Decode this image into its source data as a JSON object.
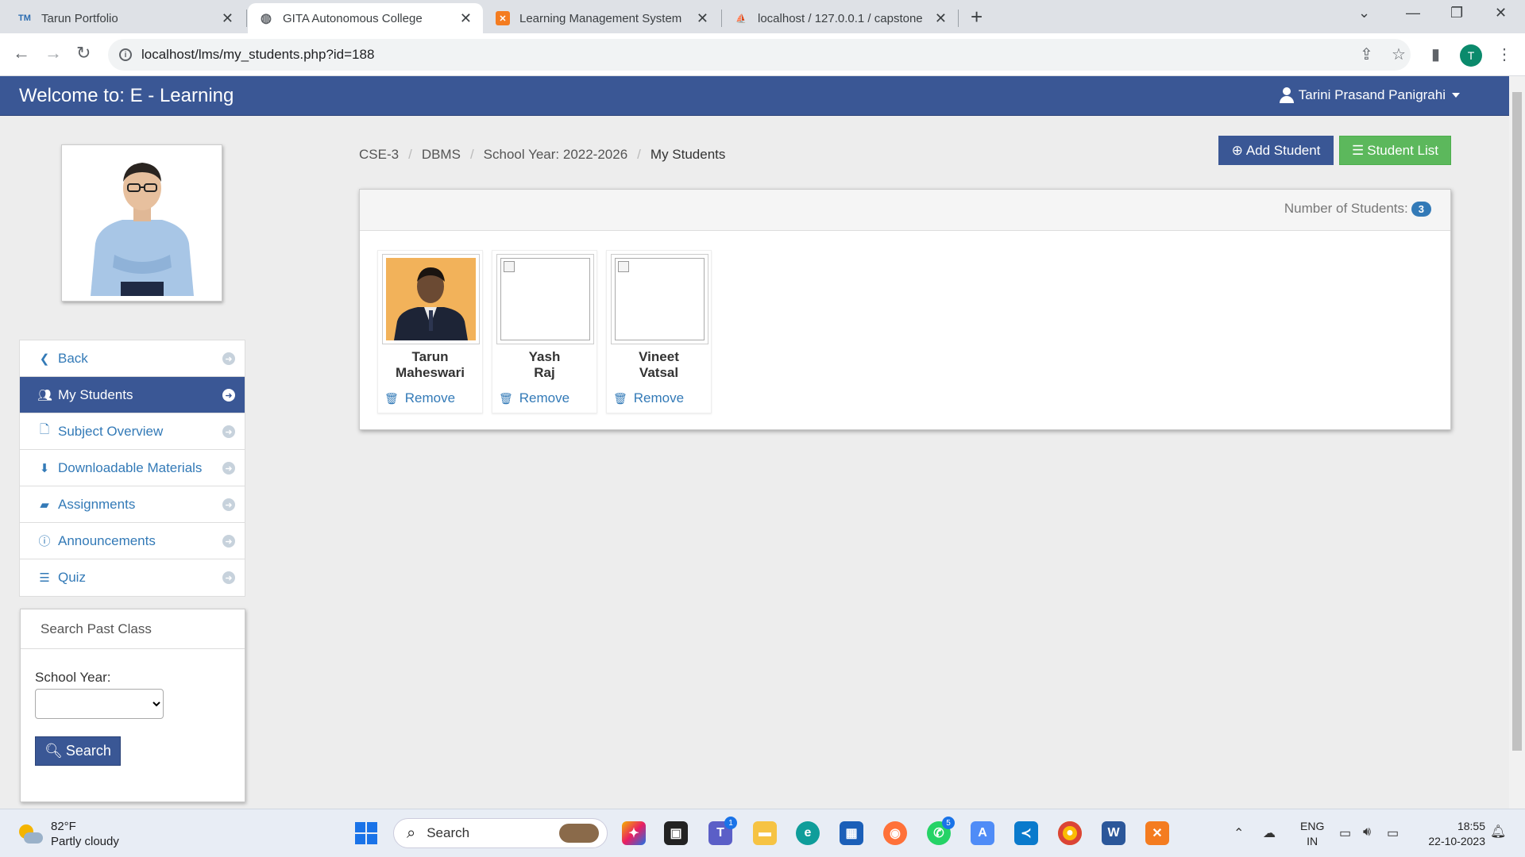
{
  "browser": {
    "tabs": [
      {
        "title": "Tarun Portfolio",
        "favicon": "TM"
      },
      {
        "title": "GITA Autonomous College",
        "favicon": "globe"
      },
      {
        "title": "Learning Management System",
        "favicon": "xampp"
      },
      {
        "title": "localhost / 127.0.0.1 / capstone",
        "favicon": "pma"
      }
    ],
    "url": "localhost/lms/my_students.php?id=188",
    "profile_initial": "T"
  },
  "header": {
    "brand": "Welcome to: E - Learning",
    "user": "Tarini Prasand Panigrahi"
  },
  "sidebar": {
    "items": [
      {
        "label": "Back",
        "icon": "chevron-left-icon"
      },
      {
        "label": "My Students",
        "icon": "users-icon",
        "active": true
      },
      {
        "label": "Subject Overview",
        "icon": "file-icon"
      },
      {
        "label": "Downloadable Materials",
        "icon": "download-icon"
      },
      {
        "label": "Assignments",
        "icon": "book-icon"
      },
      {
        "label": "Announcements",
        "icon": "info-icon"
      },
      {
        "label": "Quiz",
        "icon": "list-icon"
      }
    ],
    "search": {
      "title": "Search Past Class",
      "school_year_label": "School Year:",
      "button": "Search"
    }
  },
  "breadcrumb": [
    "CSE-3",
    "DBMS",
    "School Year: 2022-2026",
    "My Students"
  ],
  "actions": {
    "add_student": "Add Student",
    "student_list": "Student List"
  },
  "students_panel": {
    "count_label": "Number of Students:",
    "count": "3",
    "remove_label": "Remove",
    "students": [
      {
        "first": "Tarun",
        "last": "Maheswari",
        "has_photo": true
      },
      {
        "first": "Yash",
        "last": "Raj",
        "has_photo": false
      },
      {
        "first": "Vineet",
        "last": "Vatsal",
        "has_photo": false
      }
    ]
  },
  "taskbar": {
    "weather_temp": "82°F",
    "weather_desc": "Partly cloudy",
    "search": "Search",
    "lang_1": "ENG",
    "lang_2": "IN",
    "time": "18:55",
    "date": "22-10-2023",
    "teams_badge": "1",
    "whatsapp_badge": "5"
  }
}
